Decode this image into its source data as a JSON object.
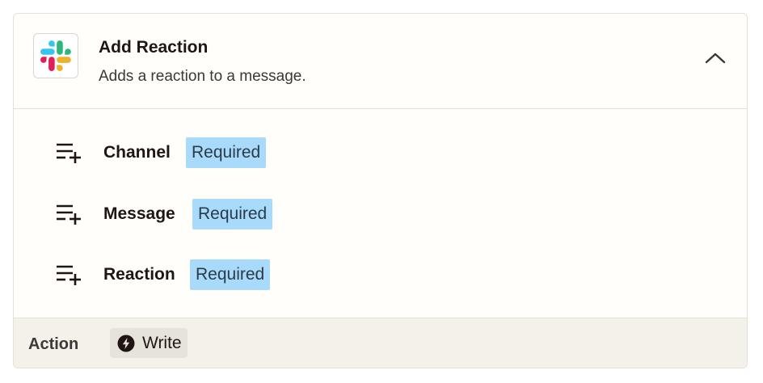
{
  "step": {
    "app_icon": "slack-logo",
    "title": "Add Reaction",
    "description": "Adds a reaction to a message.",
    "collapse_icon": "chevron-up-icon"
  },
  "fields": [
    {
      "label": "Channel",
      "badge": "Required",
      "icon": "add-field-icon"
    },
    {
      "label": "Message",
      "badge": "Required",
      "icon": "add-field-icon"
    },
    {
      "label": "Reaction",
      "badge": "Required",
      "icon": "add-field-icon"
    }
  ],
  "footer": {
    "label": "Action",
    "pill_text": "Write",
    "pill_icon": "lightning-bolt-icon"
  },
  "colors": {
    "badge_bg": "#a8dbfb",
    "footer_bg": "#f3f1ea",
    "slack_blue": "#36C5F0",
    "slack_green": "#2EB67D",
    "slack_yellow": "#ECB22E",
    "slack_red": "#E01E5A"
  }
}
